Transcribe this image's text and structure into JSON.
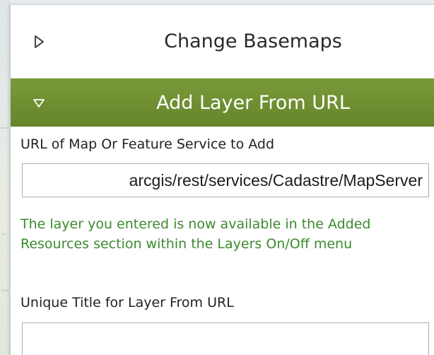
{
  "panel": {
    "sections": [
      {
        "title": "Change Basemaps",
        "state": "collapsed",
        "icon": "triangle-right-icon"
      },
      {
        "title": "Add Layer From URL",
        "state": "expanded",
        "icon": "triangle-down-icon"
      }
    ]
  },
  "form": {
    "url_label": "URL of Map Or Feature Service to Add",
    "url_value": "arcgis/rest/services/Cadastre/MapServer",
    "status_message": "The layer you entered is now available in the Added Resources section within the Layers On/Off menu",
    "title_label": "Unique Title for Layer From URL",
    "title_value": ""
  },
  "colors": {
    "header_green": "#6f8f31",
    "status_green": "#3c8a2e"
  }
}
